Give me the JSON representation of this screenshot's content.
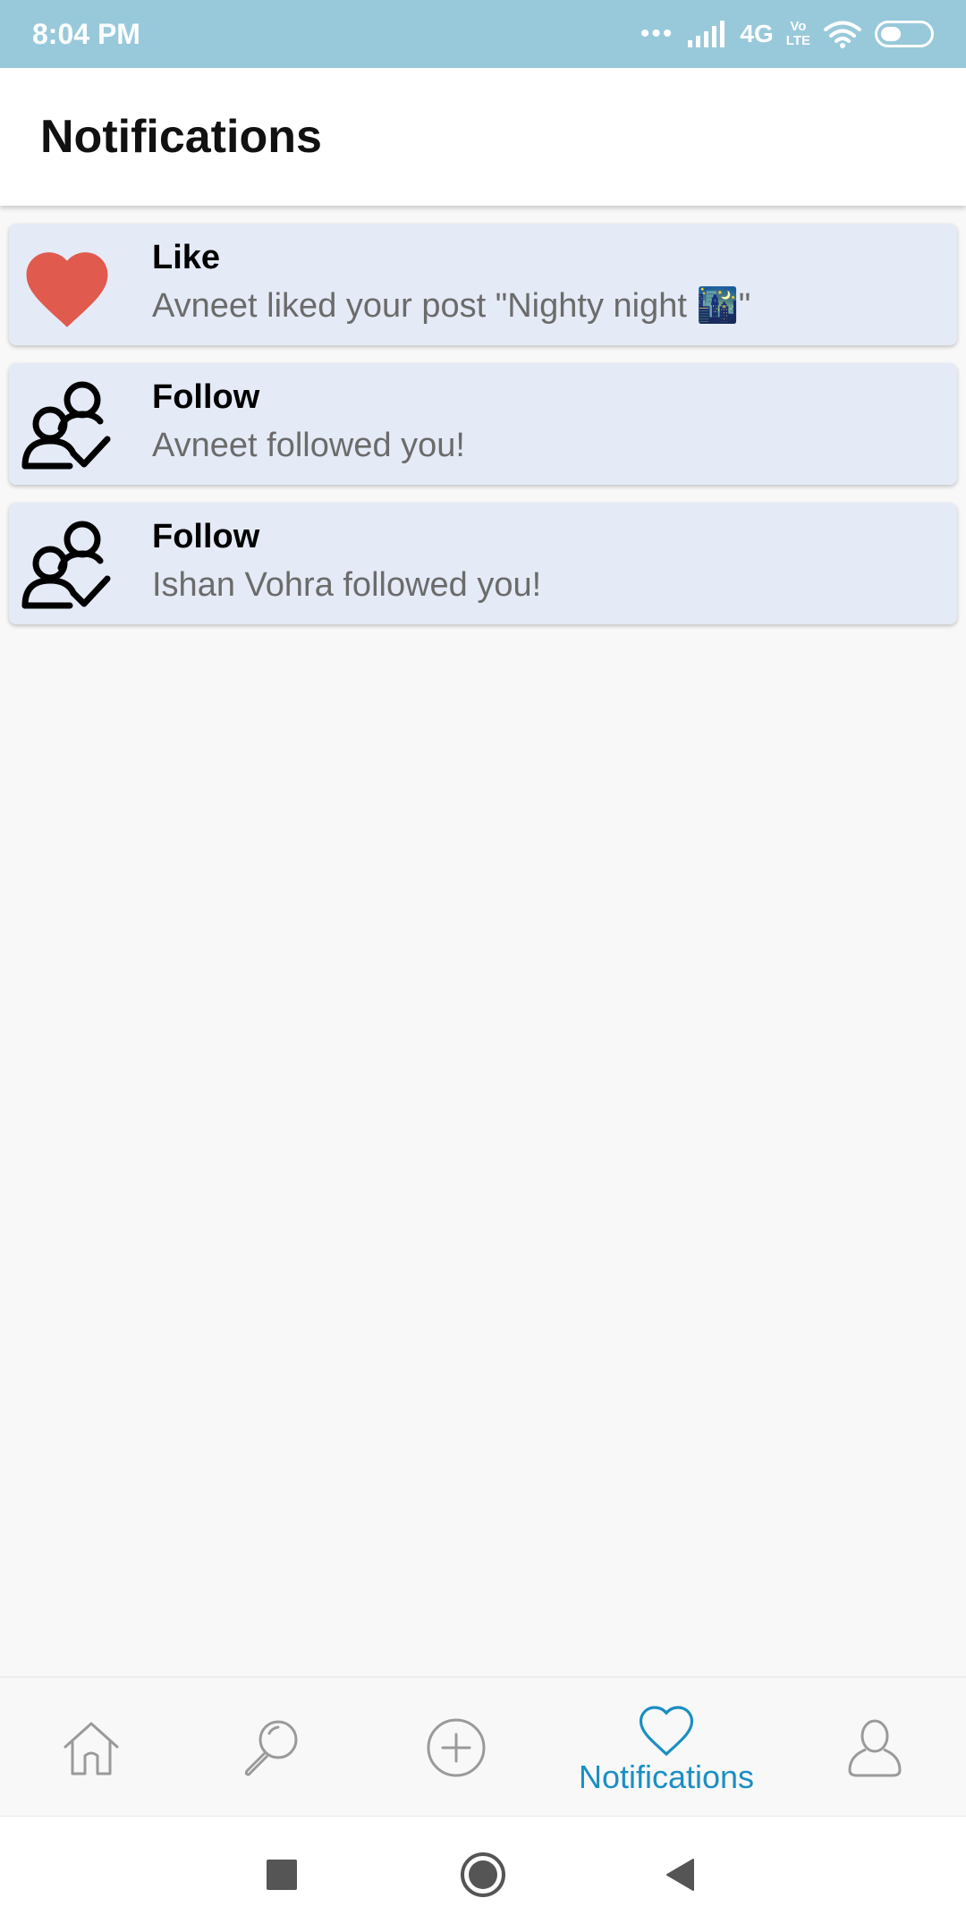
{
  "status_bar": {
    "time": "8:04 PM",
    "network": "4G",
    "volte_line1": "Vo",
    "volte_line2": "LTE"
  },
  "header": {
    "title": "Notifications"
  },
  "notifications": [
    {
      "type": "like",
      "icon": "heart-icon",
      "title": "Like",
      "body": "Avneet liked your post \"Nighty night 🌃\""
    },
    {
      "type": "follow",
      "icon": "follow-users-icon",
      "title": "Follow",
      "body": "Avneet followed you!"
    },
    {
      "type": "follow",
      "icon": "follow-users-icon",
      "title": "Follow",
      "body": "Ishan Vohra followed you!"
    }
  ],
  "bottom_nav": {
    "items": [
      {
        "icon": "home-icon",
        "label": ""
      },
      {
        "icon": "search-icon",
        "label": ""
      },
      {
        "icon": "add-circle-icon",
        "label": ""
      },
      {
        "icon": "heart-outline-icon",
        "label": "Notifications",
        "active": true
      },
      {
        "icon": "profile-icon",
        "label": ""
      }
    ]
  },
  "colors": {
    "status_bar": "#98c9da",
    "card_background": "#e4ebf6",
    "heart": "#e05a4e",
    "active_tab": "#1b8fc2",
    "inactive_icon": "#9a9a9a"
  }
}
